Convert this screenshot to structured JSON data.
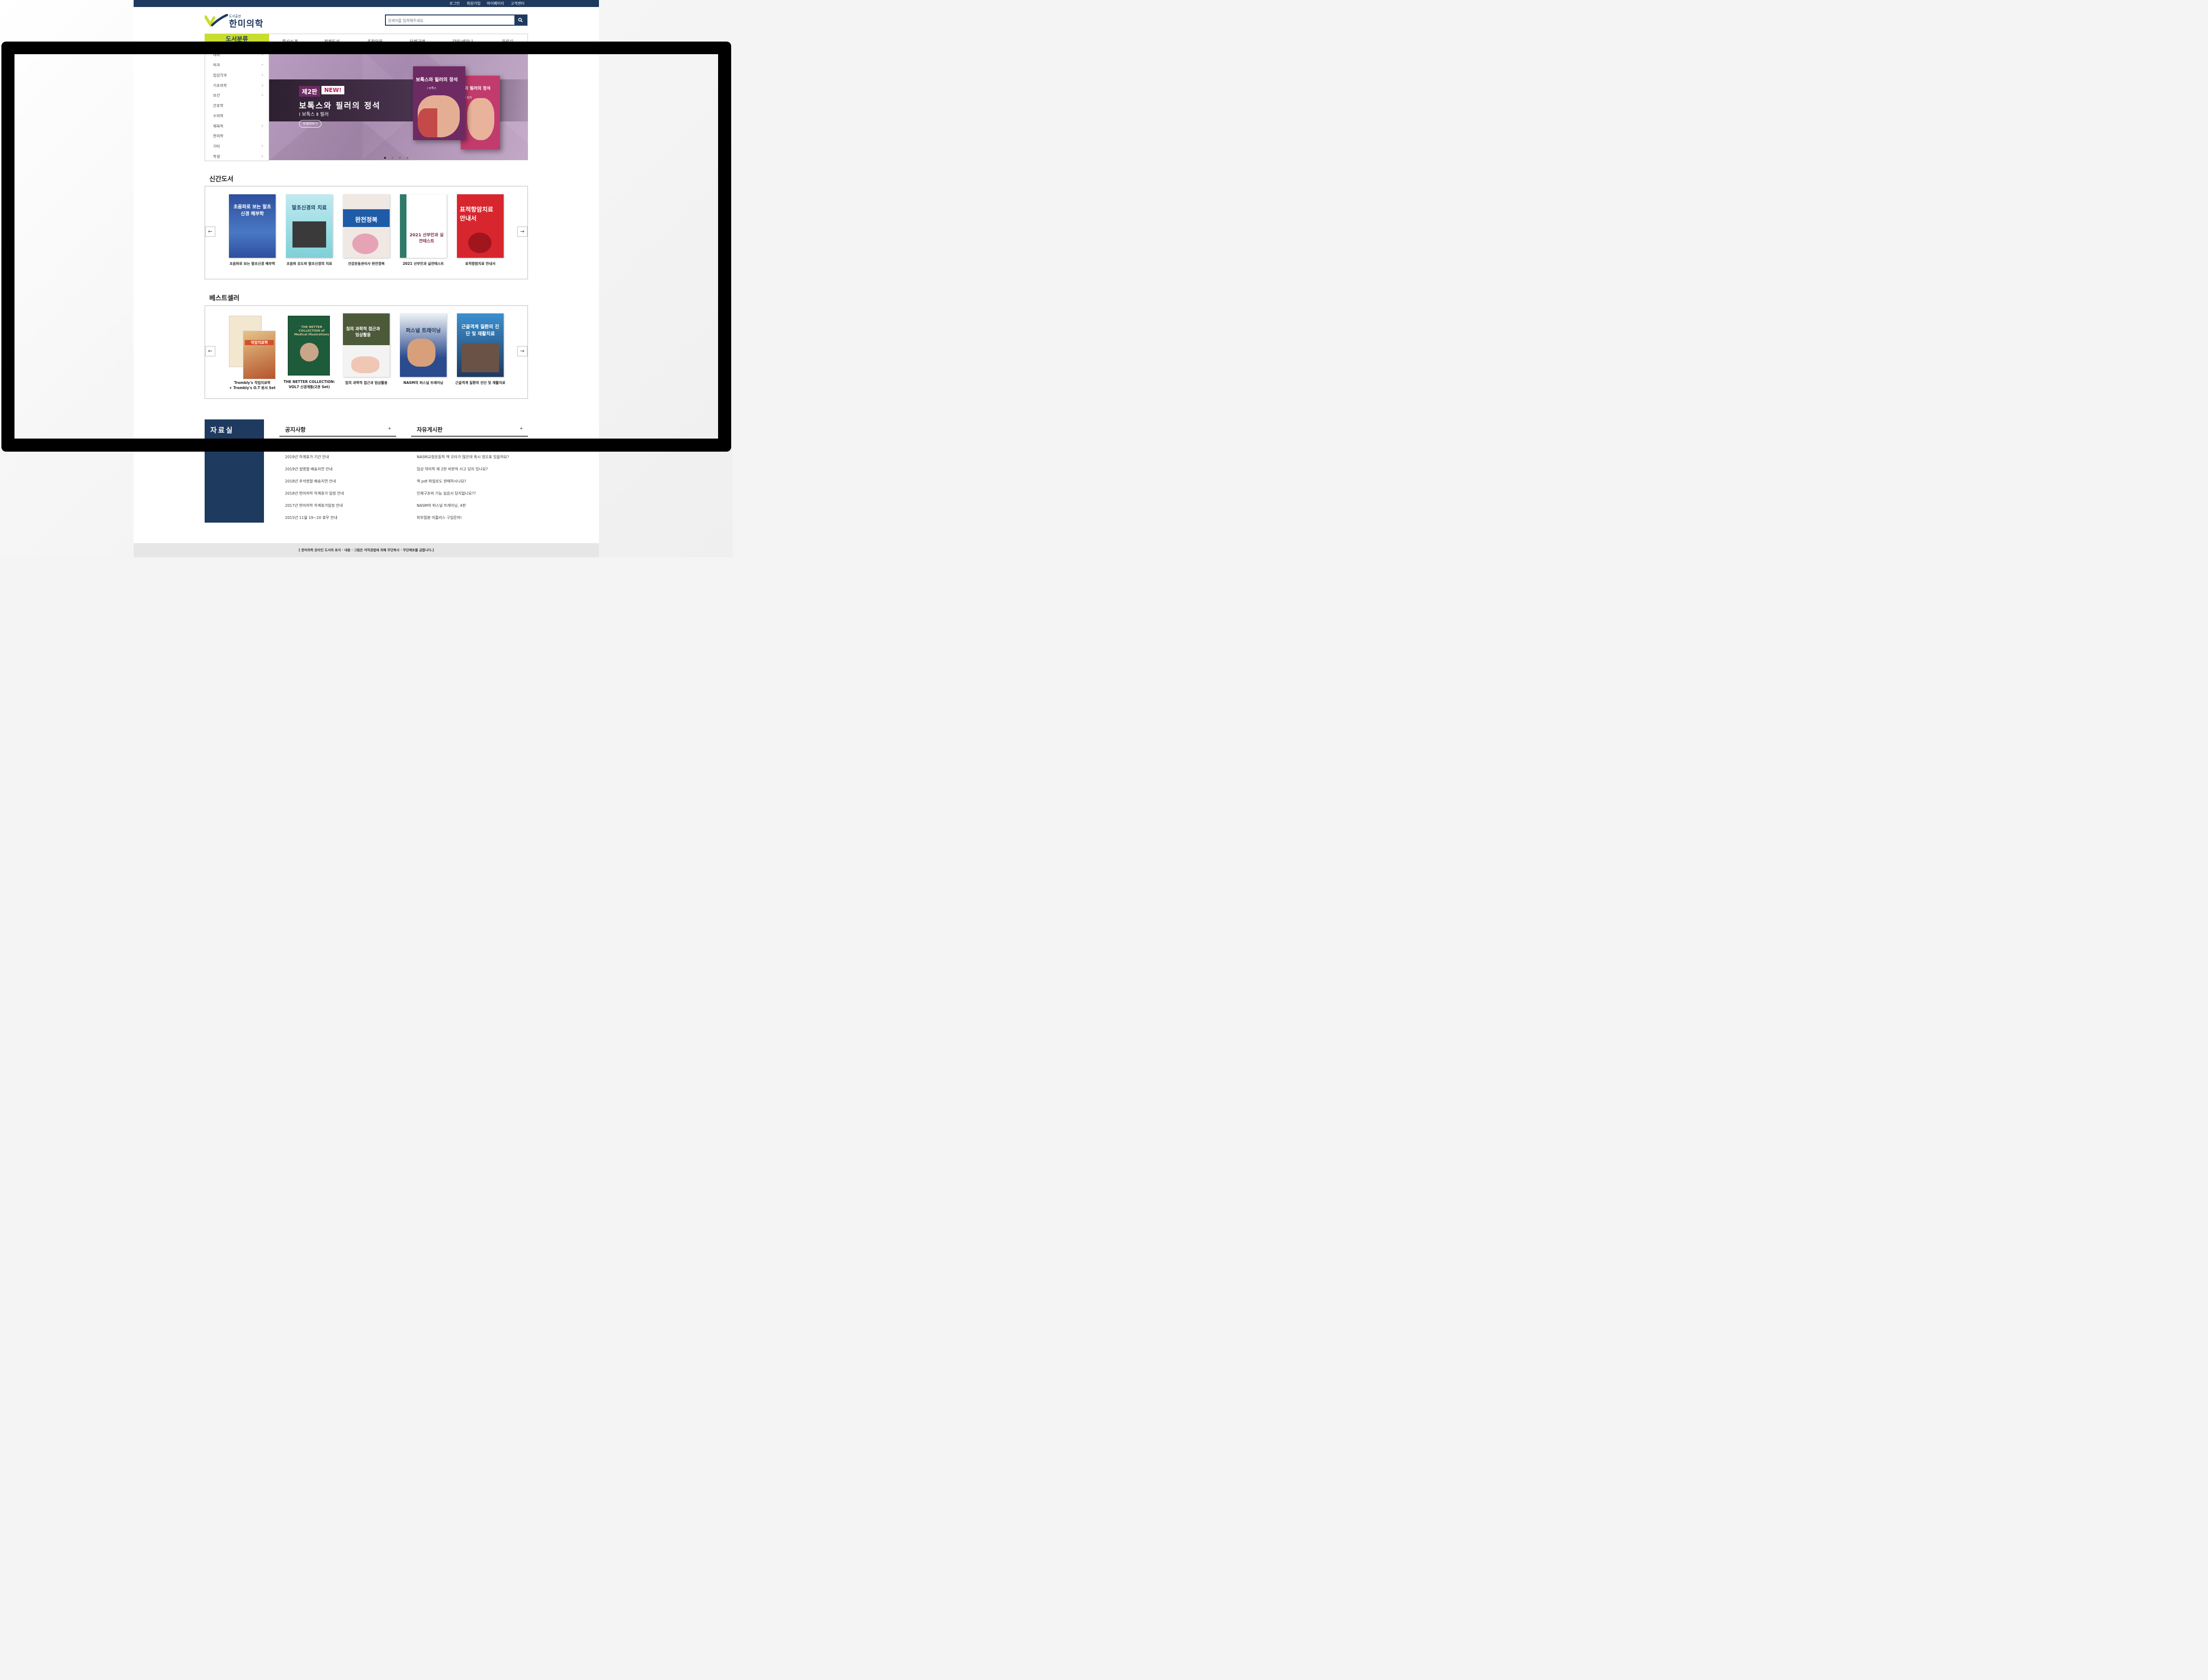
{
  "topbar": {
    "links": [
      "로그인",
      "회원가입",
      "마이페이지",
      "고객센터"
    ]
  },
  "logo": {
    "small": "도서출판",
    "name": "한미의학"
  },
  "search": {
    "placeholder": "검색어를 입력해주세요."
  },
  "nav": {
    "category_label": "도서분류",
    "items": [
      "회사소개",
      "전체도서",
      "추천모음",
      "단체구매",
      "강의/세미나",
      "자료실"
    ]
  },
  "sidebar": {
    "items": [
      {
        "label": "내과",
        "plus": "+"
      },
      {
        "label": "외과",
        "plus": "+"
      },
      {
        "label": "임상각과",
        "plus": "+"
      },
      {
        "label": "기초의학",
        "plus": "+"
      },
      {
        "label": "보건",
        "plus": "+"
      },
      {
        "label": "간호학",
        "plus": ""
      },
      {
        "label": "수의학",
        "plus": ""
      },
      {
        "label": "체육학",
        "plus": "+"
      },
      {
        "label": "한의학",
        "plus": ""
      },
      {
        "label": "기타",
        "plus": "+"
      },
      {
        "label": "학생",
        "plus": "+"
      }
    ]
  },
  "banner": {
    "edition": "제2판",
    "new": "NEW!",
    "title": "보톡스와 필러의 정석",
    "subtitle": "Ⅰ 보톡스  Ⅱ 필러",
    "button": "자세히보기",
    "book1_title": "보톡스와 필러의 정석",
    "book1_vol": "Ⅰ 보톡스",
    "book2_title": "와 필러의 정석",
    "book2_vol": "Ⅱ 필러"
  },
  "new_books": {
    "title": "신간도서",
    "prev": "←",
    "next": "→",
    "books": [
      {
        "cover_title": "초음파로 보는 말초신경 해부학",
        "caption": "초음파로 보는 말초신경 해부학",
        "color": "#2d4f9e"
      },
      {
        "cover_title": "말초신경의 치료",
        "caption": "초음파 유도하 말초신경의 치료",
        "color": "#7fd0d8"
      },
      {
        "cover_title": "완전정복",
        "caption": "건강운동관리사 완전정복",
        "color": "#f0e8e3"
      },
      {
        "cover_title": "2021 산부인과 실전테스트",
        "caption": "2021 산부인과 실전테스트",
        "color": "#ffffff"
      },
      {
        "cover_title": "표적항암치료 안내서",
        "caption": "표적항암치료 안내서",
        "color": "#d8262e"
      }
    ]
  },
  "bestsellers": {
    "title": "베스트셀러",
    "prev": "←",
    "next": "→",
    "books": [
      {
        "cover_title": "작업치료학",
        "caption_1": "Trombly's 작업치료학",
        "caption_2": "+ Trombly's O.T 원서 Set",
        "color": "#ffffff"
      },
      {
        "cover_title": "THE NETTER COLLECTION of Medical Illustrations",
        "caption_1": "THE NETTER COLLECTION:",
        "caption_2": "VOL7 신경계통(2권 Set)",
        "color": "#1e5b3a"
      },
      {
        "cover_title": "침의 과학적 접근과 임상활용",
        "caption_1": "침의 과학적 접근과 임상활용",
        "caption_2": "",
        "color": "#f3f3f3"
      },
      {
        "cover_title": "퍼스널 트레이닝",
        "caption_1": "NASM의 퍼스널 트레이닝",
        "caption_2": "",
        "color": "#2b4b8e"
      },
      {
        "cover_title": "근골격계 질환의 진단 및 재활치료",
        "caption_1": "근골격계 질환의 진단 및 재활치료",
        "caption_2": "",
        "color": "#3b90d0"
      }
    ]
  },
  "board": {
    "title": "자료실",
    "notice": {
      "title": "공지사항",
      "more": "+",
      "posts": [
        "2019년 하계휴가 기간 안내",
        "2019년 설명절 배송지연 안내",
        "2018년 추석명절 배송지연 안내",
        "2018년 한미의학 하계휴가 일정 안내",
        "2017년 한미의학 하계휴가일정 안내",
        "2015년 11월 19~20 휴무 안내"
      ]
    },
    "free": {
      "title": "자유게시판",
      "more": "+",
      "posts": [
        "NASM교정운동학 책 오타가 많은데 혹시 정오표 있을까요?",
        "임상 약리학 제 2판 비판적 사고 답지 있나요?",
        "책 pdf 파일로도 판매하시나요?",
        "인체구조와 기능 실습서 답지없나요??",
        "NASM의 퍼스널 트레이닝, 4판",
        "피부질환 아틀라스 구입문의!"
      ]
    }
  },
  "footer": {
    "text": "[ 한미의학 온라인 도서의 표지 · 내용 · 그림은 저작권법에 의해 무단복사 · 무단배포를 금합니다.]"
  },
  "colors": {
    "navy": "#1f3a5f",
    "lime": "#c9dd2f"
  }
}
